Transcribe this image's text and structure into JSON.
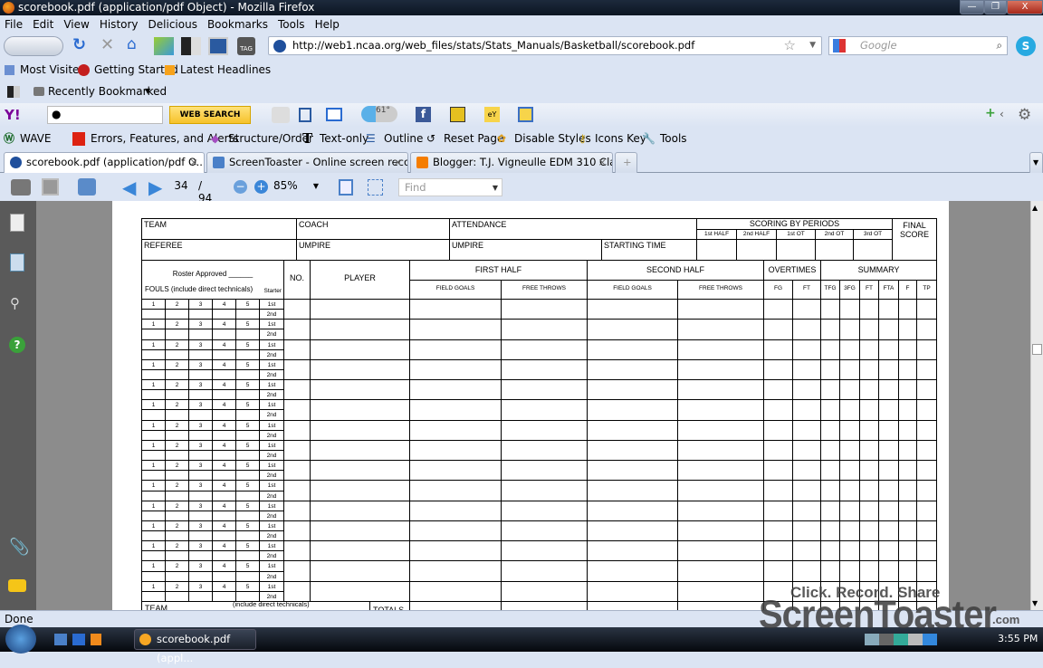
{
  "window": {
    "title": "scorebook.pdf (application/pdf Object) - Mozilla Firefox",
    "minimize": "—",
    "restore": "❐",
    "close": "X"
  },
  "menu": [
    "File",
    "Edit",
    "View",
    "History",
    "Delicious",
    "Bookmarks",
    "Tools",
    "Help"
  ],
  "nav": {
    "url": "http://web1.ncaa.org/web_files/stats/Stats_Manuals/Basketball/scorebook.pdf",
    "search_placeholder": "Google"
  },
  "bookmarks": [
    "Most Visited",
    "Getting Started",
    "Latest Headlines"
  ],
  "recently_bookmarked": "Recently Bookmarked",
  "yahoo": {
    "web_search": "WEB SEARCH",
    "weather_badge": "61°"
  },
  "wave": [
    "WAVE",
    "Errors, Features, and Alerts",
    "Structure/Order",
    "Text-only",
    "Outline",
    "Reset Page",
    "Disable Styles",
    "Icons Key",
    "Tools"
  ],
  "tabs": [
    {
      "label": "scorebook.pdf (application/pdf O...",
      "active": true
    },
    {
      "label": "ScreenToaster - Online screen recor...",
      "active": false
    },
    {
      "label": "Blogger: T.J. Vigneulle EDM 310 Cla...",
      "active": false
    }
  ],
  "pdf_toolbar": {
    "page": "34",
    "page_total": "/ 94",
    "zoom": "85%",
    "find_placeholder": "Find"
  },
  "scoresheet": {
    "team": "TEAM",
    "coach": "COACH",
    "attendance": "ATTENDANCE",
    "scoring_by_periods": "SCORING BY PERIODS",
    "periods": [
      "1st HALF",
      "2nd HALF",
      "1st OT",
      "2nd OT",
      "3rd OT"
    ],
    "final_score": "FINAL SCORE",
    "referee": "REFEREE",
    "umpire1": "UMPIRE",
    "umpire2": "UMPIRE",
    "starting_time": "STARTING TIME",
    "roster_approved": "Roster Approved ______",
    "fouls": "FOULS (include direct technicals)",
    "starter": "Starter",
    "no": "NO.",
    "player": "PLAYER",
    "first_half": "FIRST HALF",
    "second_half": "SECOND HALF",
    "overtimes": "OVERTIMES",
    "summary": "SUMMARY",
    "field_goals": "FIELD GOALS",
    "free_throws": "FREE THROWS",
    "ot_cols": [
      "FG",
      "FT"
    ],
    "summary_cols": [
      "TFG",
      "3FG",
      "FT",
      "FTA",
      "F",
      "TP"
    ],
    "foul_numbers": [
      "1",
      "2",
      "3",
      "4",
      "5"
    ],
    "halves": [
      "1st",
      "2nd"
    ],
    "team_footer": "TEAM",
    "team_footer_note": "(include direct technicals)",
    "totals": "TOTALS"
  },
  "status": "Done",
  "watermark": {
    "line1": "Click. Record. Share",
    "line2": "ScreenToaster",
    "suffix": ".com"
  },
  "taskbar": {
    "window": "scorebook.pdf (appl...",
    "clock": "3:55 PM"
  }
}
